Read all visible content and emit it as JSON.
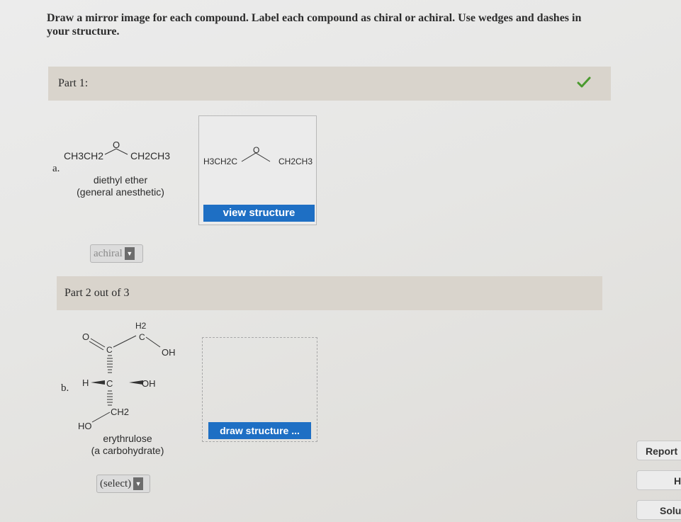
{
  "instructions": "Draw a mirror image for each compound. Label each compound as chiral or achiral. Use wedges and dashes in your structure.",
  "part1": {
    "title": "Part 1:",
    "status_icon": "check-icon",
    "letter": "a.",
    "structure": {
      "left": "CH3CH2",
      "o": "O",
      "right": "CH2CH3"
    },
    "name": "diethyl ether",
    "note": "(general anesthetic)",
    "answer": {
      "left": "H3CH2C",
      "o": "O",
      "right": "CH2CH3"
    },
    "view_button": "view structure",
    "select_value": "achiral"
  },
  "part2": {
    "title": "Part 2 out of 3",
    "letter": "b.",
    "structure": {
      "o": "O",
      "c_carbonyl": "C",
      "h2": "H2",
      "c_top": "C",
      "oh_top": "OH",
      "h": "H",
      "c_mid": "C",
      "oh_mid": "OH",
      "ch2": "CH2",
      "ho": "HO"
    },
    "name": "erythrulose",
    "note": "(a carbohydrate)",
    "draw_button": "draw structure ...",
    "select_value": "(select)"
  },
  "side_buttons": {
    "report": "Report",
    "h": "H",
    "solu": "Solu"
  },
  "colors": {
    "blue_button": "#1e6fc4",
    "check": "#4a9a2e",
    "header_bg": "#d9d4cc"
  }
}
